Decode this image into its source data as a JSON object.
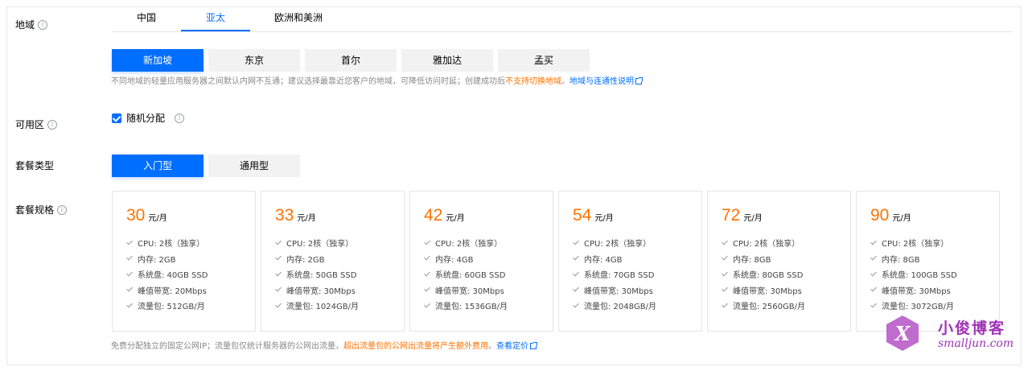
{
  "region": {
    "label": "地域",
    "tabs": [
      "中国",
      "亚太",
      "欧洲和美洲"
    ],
    "active_tab": 1,
    "cities": [
      "新加坡",
      "东京",
      "首尔",
      "雅加达",
      "孟买"
    ],
    "active_city": 0,
    "hint_text": "不同地域的轻量应用服务器之间默认内网不互通；建议选择最靠近您客户的地域，可降低访问时延；创建成功后",
    "hint_warn": "不支持切换地域",
    "hint_sep": "。",
    "hint_link": "地域与连通性说明"
  },
  "zone": {
    "label": "可用区",
    "checkbox_label": "随机分配",
    "checked": true
  },
  "package_type": {
    "label": "套餐类型",
    "options": [
      "入门型",
      "通用型"
    ],
    "active": 0
  },
  "package_spec": {
    "label": "套餐规格",
    "unit": "元/月",
    "cards": [
      {
        "price": "30",
        "specs": [
          "CPU: 2核（独享）",
          "内存: 2GB",
          "系统盘: 40GB SSD",
          "峰值带宽: 20Mbps",
          "流量包: 512GB/月"
        ]
      },
      {
        "price": "33",
        "specs": [
          "CPU: 2核（独享）",
          "内存: 2GB",
          "系统盘: 50GB SSD",
          "峰值带宽: 30Mbps",
          "流量包: 1024GB/月"
        ]
      },
      {
        "price": "42",
        "specs": [
          "CPU: 2核（独享）",
          "内存: 4GB",
          "系统盘: 60GB SSD",
          "峰值带宽: 30Mbps",
          "流量包: 1536GB/月"
        ]
      },
      {
        "price": "54",
        "specs": [
          "CPU: 2核（独享）",
          "内存: 4GB",
          "系统盘: 70GB SSD",
          "峰值带宽: 30Mbps",
          "流量包: 2048GB/月"
        ]
      },
      {
        "price": "72",
        "specs": [
          "CPU: 2核（独享）",
          "内存: 8GB",
          "系统盘: 80GB SSD",
          "峰值带宽: 30Mbps",
          "流量包: 2560GB/月"
        ]
      },
      {
        "price": "90",
        "specs": [
          "CPU: 2核（独享）",
          "内存: 8GB",
          "系统盘: 100GB SSD",
          "峰值带宽: 30Mbps",
          "流量包: 3072GB/月"
        ]
      }
    ],
    "foot_text": "免费分配独立的固定公网IP；流量包仅统计服务器的公网出流量，",
    "foot_warn": "超出流量包的公网出流量将产生额外费用",
    "foot_sep": "。",
    "foot_link": "查看定价"
  },
  "watermark": {
    "title": "小俊博客",
    "subtitle": "smalljun.com"
  },
  "colors": {
    "accent": "#006eff",
    "price": "#ff7200",
    "warn": "#ff7200"
  }
}
